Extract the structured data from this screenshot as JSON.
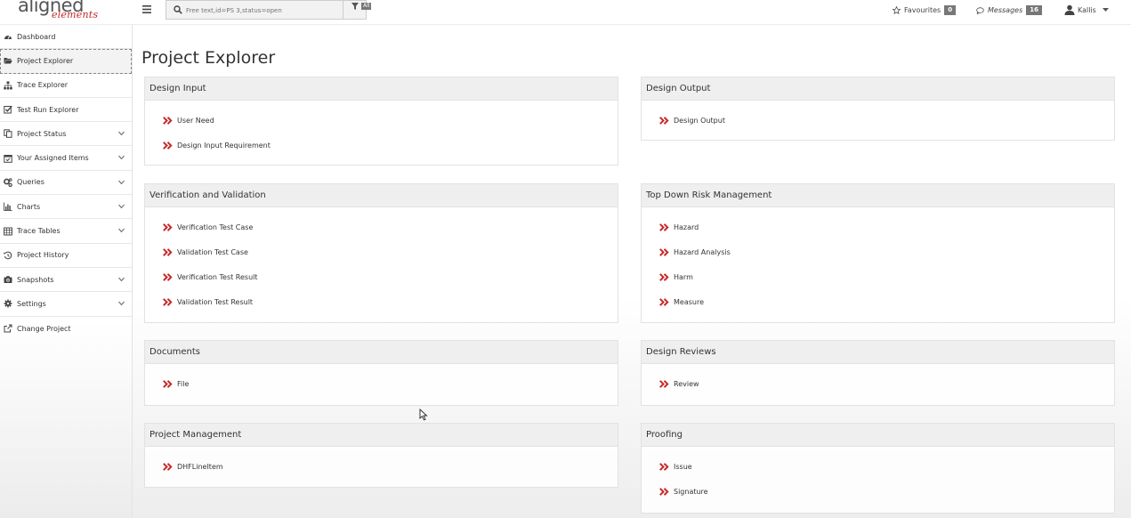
{
  "header": {
    "logo_main": "aligned",
    "logo_sub": "elements",
    "search_placeholder": "Free text,id=PS 3,status=open",
    "filter_badge": "All",
    "favourites_label": "Favourites",
    "favourites_count": "0",
    "messages_label": "Messages",
    "messages_count": "16",
    "user_name": "Kallis"
  },
  "sidebar": {
    "items": [
      {
        "label": "Dashboard",
        "icon": "dashboard-icon",
        "chevron": false
      },
      {
        "label": "Project Explorer",
        "icon": "folder-open-icon",
        "chevron": false
      },
      {
        "label": "Trace Explorer",
        "icon": "sitemap-icon",
        "chevron": false
      },
      {
        "label": "Test Run Explorer",
        "icon": "checkbox-icon",
        "chevron": false
      },
      {
        "label": "Project Status",
        "icon": "copy-icon",
        "chevron": true
      },
      {
        "label": "Your Assigned Items",
        "icon": "calendar-check-icon",
        "chevron": true
      },
      {
        "label": "Queries",
        "icon": "cogs-icon",
        "chevron": true
      },
      {
        "label": "Charts",
        "icon": "bar-chart-icon",
        "chevron": true
      },
      {
        "label": "Trace Tables",
        "icon": "table-icon",
        "chevron": true
      },
      {
        "label": "Project History",
        "icon": "history-icon",
        "chevron": false
      },
      {
        "label": "Snapshots",
        "icon": "camera-icon",
        "chevron": true
      },
      {
        "label": "Settings",
        "icon": "gear-icon",
        "chevron": true
      },
      {
        "label": "Change Project",
        "icon": "external-link-icon",
        "chevron": false
      }
    ]
  },
  "main": {
    "title": "Project Explorer",
    "panels": {
      "design_input": {
        "title": "Design Input",
        "items": [
          "User Need",
          "Design Input Requirement"
        ]
      },
      "design_output": {
        "title": "Design Output",
        "items": [
          "Design Output"
        ]
      },
      "vv": {
        "title": "Verification and Validation",
        "items": [
          "Verification Test Case",
          "Validation Test Case",
          "Verification Test Result",
          "Validation Test Result"
        ]
      },
      "risk": {
        "title": "Top Down Risk Management",
        "items": [
          "Hazard",
          "Hazard Analysis",
          "Harm",
          "Measure"
        ]
      },
      "documents": {
        "title": "Documents",
        "items": [
          "File"
        ]
      },
      "reviews": {
        "title": "Design Reviews",
        "items": [
          "Review"
        ]
      },
      "pm": {
        "title": "Project Management",
        "items": [
          "DHFLineItem"
        ]
      },
      "proofing": {
        "title": "Proofing",
        "items": [
          "Issue",
          "Signature"
        ]
      }
    }
  },
  "colors": {
    "accent_red": "#c62828",
    "badge_grey": "#777777"
  }
}
